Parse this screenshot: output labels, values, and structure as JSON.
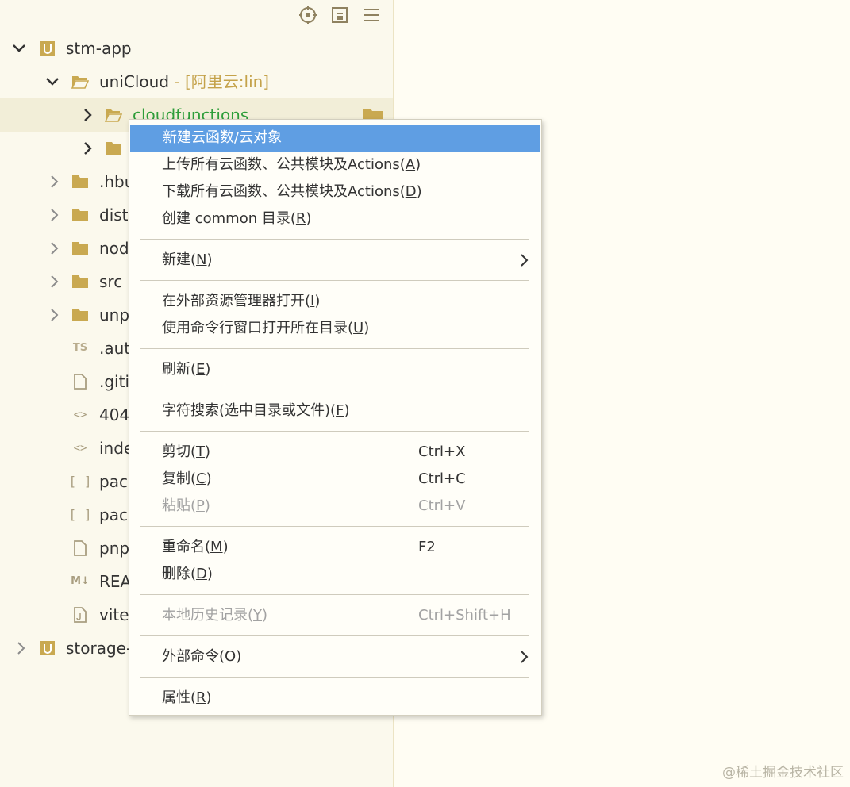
{
  "tree": {
    "rows": [
      {
        "name": "stm-app",
        "type": "project"
      },
      {
        "name": "uniCloud",
        "tag": " - [阿里云:lin]",
        "type": "folder-open"
      },
      {
        "name": "cloudfunctions",
        "type": "folder-open"
      },
      {
        "name": "",
        "type": "folder"
      },
      {
        "name": ".hbu",
        "type": "folder"
      },
      {
        "name": "dist",
        "type": "folder"
      },
      {
        "name": "nod",
        "type": "folder"
      },
      {
        "name": "src",
        "type": "folder"
      },
      {
        "name": "unp",
        "type": "folder"
      },
      {
        "name": ".aut",
        "type": "ts-file",
        "icon_text": "TS"
      },
      {
        "name": ".giti",
        "type": "file"
      },
      {
        "name": "404",
        "type": "html-file",
        "icon_text": "<>"
      },
      {
        "name": "inde",
        "type": "html-file",
        "icon_text": "<>"
      },
      {
        "name": "pac",
        "type": "json-file",
        "icon_text": "[ ]"
      },
      {
        "name": "pac",
        "type": "json-file",
        "icon_text": "[ ]"
      },
      {
        "name": "pnp",
        "type": "file"
      },
      {
        "name": "REA",
        "type": "md-file",
        "icon_text": "M↓"
      },
      {
        "name": "vite",
        "type": "js-file"
      },
      {
        "name": "storage-",
        "type": "project"
      }
    ]
  },
  "menu": {
    "items": [
      {
        "label": "新建云函数/云对象",
        "highlight": true
      },
      {
        "label": "上传所有云函数、公共模块及Actions(",
        "key": "A",
        "after": ")"
      },
      {
        "label": "下载所有云函数、公共模块及Actions(",
        "key": "D",
        "after": ")"
      },
      {
        "label": "创建 common 目录(",
        "key": "R",
        "after": ")"
      },
      {
        "label": "新建(",
        "key": "N",
        "after": ")",
        "submenu": true
      },
      {
        "label": "在外部资源管理器打开(",
        "key": "I",
        "after": ")"
      },
      {
        "label": "使用命令行窗口打开所在目录(",
        "key": "U",
        "after": ")"
      },
      {
        "label": "刷新(",
        "key": "E",
        "after": ")"
      },
      {
        "label": "字符搜索(选中目录或文件)(",
        "key": "F",
        "after": ")"
      },
      {
        "label": "剪切(",
        "key": "T",
        "after": ")",
        "shortcut": "Ctrl+X"
      },
      {
        "label": "复制(",
        "key": "C",
        "after": ")",
        "shortcut": "Ctrl+C"
      },
      {
        "label": "粘贴(",
        "key": "P",
        "after": ")",
        "shortcut": "Ctrl+V",
        "disabled": true
      },
      {
        "label": "重命名(",
        "key": "M",
        "after": ")",
        "shortcut": "F2"
      },
      {
        "label": "删除(",
        "key": "D",
        "after": ")"
      },
      {
        "label": "本地历史记录(",
        "key": "Y",
        "after": ")",
        "shortcut": "Ctrl+Shift+H",
        "disabled": true
      },
      {
        "label": "外部命令(",
        "key": "O",
        "after": ")",
        "submenu": true
      },
      {
        "label": "属性(",
        "key": "R",
        "after": ")"
      }
    ]
  },
  "watermark": "@稀土掘金技术社区",
  "colors": {
    "highlight": "#5f9ee3",
    "folder": "#c9a951",
    "green_text": "#2e9d3a",
    "tag_text": "#c4a24a"
  }
}
